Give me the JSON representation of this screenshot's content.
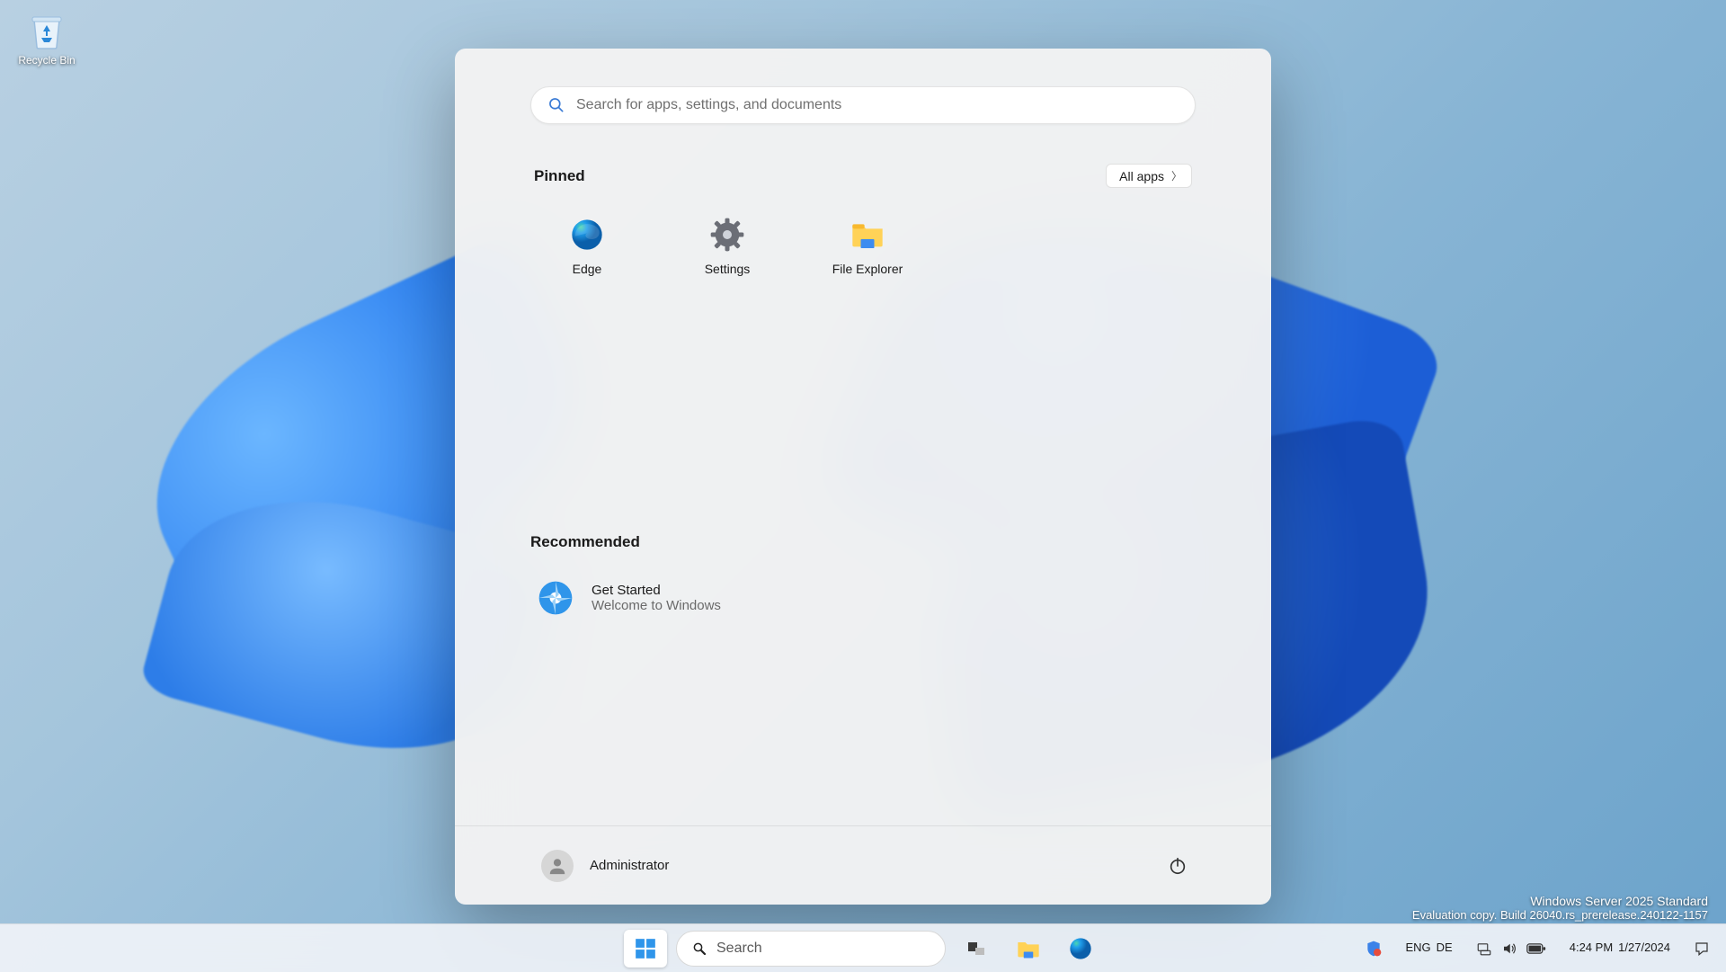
{
  "desktop": {
    "recycle_bin_label": "Recycle Bin"
  },
  "watermark": {
    "line1": "Windows Server 2025 Standard",
    "line2": "Evaluation copy. Build 26040.rs_prerelease.240122-1157"
  },
  "start_menu": {
    "search_placeholder": "Search for apps, settings, and documents",
    "pinned_title": "Pinned",
    "all_apps_label": "All apps",
    "pinned": [
      {
        "label": "Edge"
      },
      {
        "label": "Settings"
      },
      {
        "label": "File Explorer"
      }
    ],
    "recommended_title": "Recommended",
    "recommended": [
      {
        "title": "Get Started",
        "subtitle": "Welcome to Windows"
      }
    ],
    "user": "Administrator"
  },
  "taskbar": {
    "search_label": "Search",
    "language": {
      "primary": "ENG",
      "secondary": "DE"
    },
    "clock": {
      "time": "4:24 PM",
      "date": "1/27/2024"
    }
  }
}
